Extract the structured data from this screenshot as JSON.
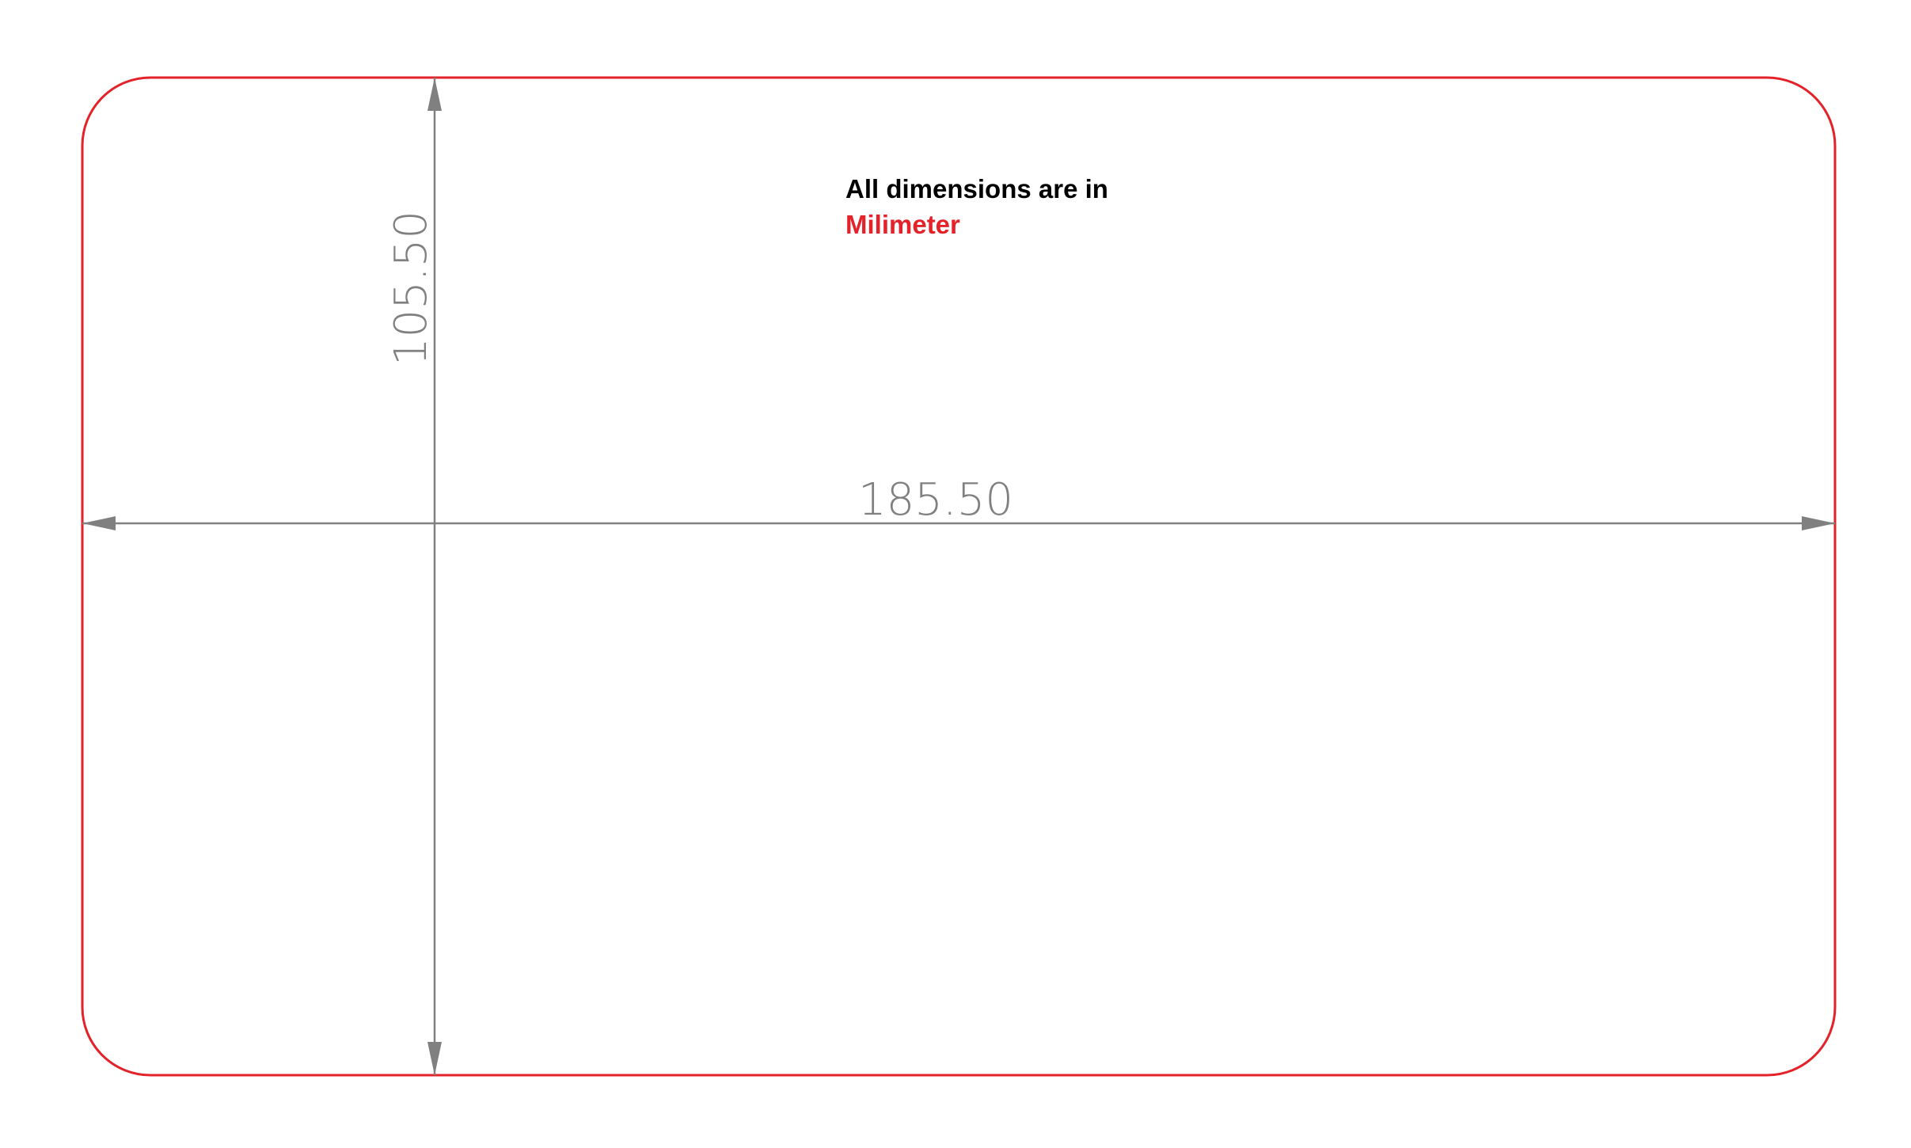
{
  "dimensions": {
    "width_label": "185.50",
    "height_label": "105.50"
  },
  "note": {
    "line1": "All dimensions are in",
    "line2": "Milimeter"
  },
  "colors": {
    "outline": "#e32229",
    "dimension": "#808080",
    "note_text": "#000000",
    "unit_text": "#e32229",
    "background": "#ffffff"
  }
}
